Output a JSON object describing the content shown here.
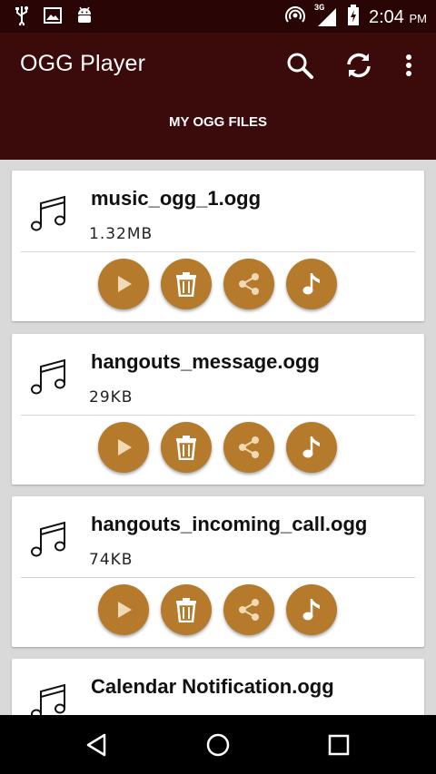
{
  "status_bar": {
    "icons_left": [
      "usb-icon",
      "image-icon",
      "android-icon"
    ],
    "icons_right": [
      "hotspot-icon",
      "signal-3g-icon",
      "battery-icon"
    ],
    "network_label": "3G",
    "time": "2:04",
    "ampm": "PM"
  },
  "app_bar": {
    "title": "OGG Player",
    "actions": [
      "search-icon",
      "refresh-icon",
      "more-vert-icon"
    ],
    "tab_label": "MY OGG FILES"
  },
  "files": [
    {
      "name": "music_ogg_1.ogg",
      "size": "1.32MB"
    },
    {
      "name": "hangouts_message.ogg",
      "size": "29KB"
    },
    {
      "name": "hangouts_incoming_call.ogg",
      "size": "74KB"
    },
    {
      "name": "Calendar Notification.ogg",
      "size": ""
    }
  ],
  "card_buttons": [
    "play-icon",
    "delete-icon",
    "share-icon",
    "set-ringtone-icon"
  ],
  "colors": {
    "status_bar": "#2a0505",
    "app_bar": "#3b0a0a",
    "accent": "#b67a2c",
    "background": "#d9d9d9"
  },
  "nav": [
    "back-icon",
    "home-icon",
    "recents-icon"
  ]
}
